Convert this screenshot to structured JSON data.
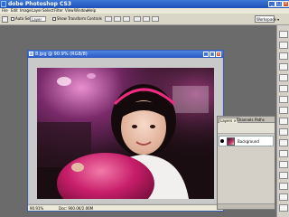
{
  "app": {
    "title": "dobe Photoshop CS3"
  },
  "window_controls": {
    "minimize": "_",
    "maximize": "□",
    "close": "×"
  },
  "menu": [
    {
      "label": "File"
    },
    {
      "label": "Edit"
    },
    {
      "label": "Image"
    },
    {
      "label": "Layer"
    },
    {
      "label": "Select"
    },
    {
      "label": "Filter"
    },
    {
      "label": "View"
    },
    {
      "label": "Window"
    },
    {
      "label": "Help"
    }
  ],
  "options_bar": {
    "auto_select_label": "Auto Select",
    "auto_select_value": "Layer",
    "show_transform_label": "Show Transform Controls",
    "workspace_label": "Workspace ▾"
  },
  "document": {
    "title": "8.jpg @ 90.9% (RGB/8)",
    "zoom": "90.91%",
    "doc_info": "Doc: 900.0K/2.06M"
  },
  "layers_panel": {
    "tabs": [
      "Layers ×",
      "Channels",
      "Paths"
    ],
    "layers": [
      {
        "name": "Background"
      }
    ]
  },
  "colors": {
    "titlebar": "#1d4fb8",
    "workspace": "#6b6b6b",
    "balloon": "#c81e6a",
    "dress": "#f2f0ee"
  }
}
